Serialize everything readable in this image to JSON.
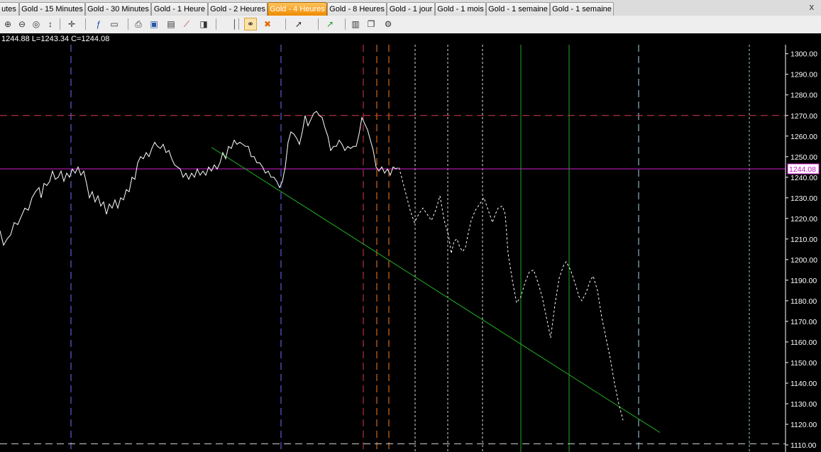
{
  "tabs": [
    {
      "label": "utes",
      "width": 27
    },
    {
      "label": "Gold - 15 Minutes",
      "width": 91
    },
    {
      "label": "Gold - 30 Minutes",
      "width": 91
    },
    {
      "label": "Gold - 1 Heure",
      "width": 78
    },
    {
      "label": "Gold - 2 Heures",
      "width": 82
    },
    {
      "label": "Gold - 4 Heures",
      "width": 82,
      "active": true
    },
    {
      "label": "Gold - 8 Heures",
      "width": 82
    },
    {
      "label": "Gold - 1 jour",
      "width": 66
    },
    {
      "label": "Gold - 1 mois",
      "width": 70
    },
    {
      "label": "Gold - 1 semaine",
      "width": 88
    },
    {
      "label": "Gold - 1 semaine",
      "width": 88
    }
  ],
  "close_label": "x",
  "toolbar": {
    "icons": [
      "zoom-in-icon",
      "zoom-out-icon",
      "zoom-fit-icon",
      "scale-icon",
      "crosshair-icon",
      "function-icon",
      "indicator-window-icon",
      "print-icon",
      "save-icon",
      "document-icon",
      "chart-line-icon",
      "save-template-icon",
      "vertical-line-icon",
      "link-icon",
      "cross-icon",
      "cursor-icon",
      "trendline-icon",
      "object-list-icon",
      "copy-icon",
      "tools-icon"
    ]
  },
  "ohlc_text": "1244.88 L=1243.34 C=1244.08",
  "chart_data": {
    "type": "line",
    "ylim": [
      1110,
      1303
    ],
    "yticks": [
      1110,
      1120,
      1130,
      1140,
      1150,
      1160,
      1170,
      1180,
      1190,
      1200,
      1210,
      1220,
      1230,
      1240,
      1250,
      1260,
      1270,
      1280,
      1290,
      1300
    ],
    "last_price": 1244.08,
    "last_price_label": "1244.08",
    "colors": {
      "price": "#ffffff",
      "hline_red": "#d43a55",
      "hline_magenta": "#d11fd1",
      "trend": "#22aa22"
    },
    "series_solid": [
      [
        0,
        1214
      ],
      [
        5,
        1207
      ],
      [
        10,
        1210
      ],
      [
        15,
        1212
      ],
      [
        20,
        1218
      ],
      [
        25,
        1217
      ],
      [
        30,
        1221
      ],
      [
        35,
        1225
      ],
      [
        40,
        1224
      ],
      [
        45,
        1230
      ],
      [
        50,
        1233
      ],
      [
        55,
        1235
      ],
      [
        58,
        1230
      ],
      [
        62,
        1237
      ],
      [
        66,
        1236
      ],
      [
        70,
        1238
      ],
      [
        74,
        1243
      ],
      [
        78,
        1239
      ],
      [
        82,
        1240
      ],
      [
        86,
        1243
      ],
      [
        90,
        1238
      ],
      [
        94,
        1242
      ],
      [
        98,
        1240
      ],
      [
        102,
        1244
      ],
      [
        106,
        1242
      ],
      [
        110,
        1245
      ],
      [
        114,
        1241
      ],
      [
        118,
        1243
      ],
      [
        122,
        1237
      ],
      [
        126,
        1230
      ],
      [
        130,
        1233
      ],
      [
        134,
        1228
      ],
      [
        138,
        1231
      ],
      [
        142,
        1226
      ],
      [
        146,
        1228
      ],
      [
        150,
        1222
      ],
      [
        154,
        1227
      ],
      [
        158,
        1225
      ],
      [
        162,
        1229
      ],
      [
        166,
        1225
      ],
      [
        170,
        1230
      ],
      [
        174,
        1229
      ],
      [
        178,
        1234
      ],
      [
        182,
        1233
      ],
      [
        186,
        1240
      ],
      [
        190,
        1239
      ],
      [
        194,
        1247
      ],
      [
        198,
        1250
      ],
      [
        202,
        1249
      ],
      [
        206,
        1252
      ],
      [
        210,
        1250
      ],
      [
        214,
        1254
      ],
      [
        218,
        1257
      ],
      [
        222,
        1255
      ],
      [
        226,
        1254
      ],
      [
        230,
        1256
      ],
      [
        234,
        1252
      ],
      [
        238,
        1253
      ],
      [
        242,
        1249
      ],
      [
        246,
        1246
      ],
      [
        250,
        1245
      ],
      [
        254,
        1244
      ],
      [
        258,
        1240
      ],
      [
        262,
        1242
      ],
      [
        266,
        1239
      ],
      [
        270,
        1242
      ],
      [
        274,
        1240
      ],
      [
        278,
        1244
      ],
      [
        282,
        1241
      ],
      [
        286,
        1243
      ],
      [
        290,
        1241
      ],
      [
        294,
        1245
      ],
      [
        298,
        1243
      ],
      [
        302,
        1246
      ],
      [
        306,
        1244
      ],
      [
        310,
        1247
      ],
      [
        314,
        1252
      ],
      [
        318,
        1249
      ],
      [
        322,
        1255
      ],
      [
        326,
        1254
      ],
      [
        330,
        1258
      ],
      [
        334,
        1256
      ],
      [
        338,
        1257
      ],
      [
        342,
        1256
      ],
      [
        346,
        1255
      ],
      [
        350,
        1255
      ],
      [
        354,
        1250
      ],
      [
        358,
        1250
      ],
      [
        362,
        1247
      ],
      [
        366,
        1247
      ],
      [
        370,
        1245
      ],
      [
        374,
        1242
      ],
      [
        378,
        1243
      ],
      [
        382,
        1240
      ],
      [
        386,
        1240
      ],
      [
        390,
        1238
      ],
      [
        394,
        1235
      ],
      [
        398,
        1238
      ],
      [
        402,
        1245
      ],
      [
        406,
        1257
      ],
      [
        410,
        1262
      ],
      [
        414,
        1261
      ],
      [
        418,
        1259
      ],
      [
        422,
        1256
      ],
      [
        426,
        1262
      ],
      [
        430,
        1270
      ],
      [
        434,
        1265
      ],
      [
        438,
        1268
      ],
      [
        442,
        1271
      ],
      [
        446,
        1272
      ],
      [
        450,
        1270
      ],
      [
        454,
        1269
      ],
      [
        458,
        1264
      ],
      [
        462,
        1260
      ],
      [
        466,
        1253
      ],
      [
        470,
        1255
      ],
      [
        474,
        1255
      ],
      [
        478,
        1258
      ],
      [
        482,
        1256
      ],
      [
        486,
        1253
      ],
      [
        490,
        1255
      ],
      [
        494,
        1254
      ],
      [
        498,
        1255
      ],
      [
        502,
        1255
      ],
      [
        506,
        1261
      ],
      [
        510,
        1269
      ],
      [
        514,
        1266
      ],
      [
        518,
        1263
      ],
      [
        522,
        1258
      ],
      [
        526,
        1253
      ],
      [
        530,
        1245
      ],
      [
        534,
        1243
      ],
      [
        538,
        1245
      ],
      [
        542,
        1242
      ],
      [
        546,
        1244
      ],
      [
        550,
        1241
      ],
      [
        554,
        1245
      ],
      [
        558,
        1244
      ]
    ],
    "series_dashed": [
      [
        558,
        1244
      ],
      [
        562,
        1245
      ],
      [
        566,
        1240
      ],
      [
        572,
        1232
      ],
      [
        578,
        1224
      ],
      [
        584,
        1218
      ],
      [
        590,
        1222
      ],
      [
        596,
        1225
      ],
      [
        602,
        1222
      ],
      [
        608,
        1219
      ],
      [
        614,
        1224
      ],
      [
        620,
        1231
      ],
      [
        626,
        1219
      ],
      [
        632,
        1212
      ],
      [
        636,
        1203
      ],
      [
        640,
        1209
      ],
      [
        644,
        1210
      ],
      [
        648,
        1206
      ],
      [
        652,
        1204
      ],
      [
        656,
        1206
      ],
      [
        660,
        1213
      ],
      [
        664,
        1219
      ],
      [
        670,
        1224
      ],
      [
        676,
        1227
      ],
      [
        682,
        1230
      ],
      [
        688,
        1224
      ],
      [
        694,
        1218
      ],
      [
        698,
        1222
      ],
      [
        702,
        1225
      ],
      [
        708,
        1226
      ],
      [
        712,
        1222
      ],
      [
        716,
        1203
      ],
      [
        722,
        1190
      ],
      [
        728,
        1179
      ],
      [
        734,
        1182
      ],
      [
        740,
        1189
      ],
      [
        746,
        1194
      ],
      [
        752,
        1195
      ],
      [
        758,
        1189
      ],
      [
        764,
        1182
      ],
      [
        770,
        1172
      ],
      [
        776,
        1162
      ],
      [
        782,
        1178
      ],
      [
        788,
        1191
      ],
      [
        794,
        1197
      ],
      [
        798,
        1199
      ],
      [
        804,
        1195
      ],
      [
        810,
        1189
      ],
      [
        816,
        1182
      ],
      [
        820,
        1180
      ],
      [
        826,
        1184
      ],
      [
        832,
        1190
      ],
      [
        836,
        1192
      ],
      [
        842,
        1185
      ],
      [
        848,
        1172
      ],
      [
        854,
        1162
      ],
      [
        860,
        1152
      ],
      [
        866,
        1140
      ],
      [
        872,
        1130
      ],
      [
        878,
        1122
      ]
    ]
  },
  "guides": {
    "trendline": [
      [
        298,
        1254.5
      ],
      [
        930,
        1116
      ]
    ],
    "hlines": [
      {
        "y": 1270,
        "color": "#d43a55",
        "dash": "10,6",
        "w": 1
      },
      {
        "y": 1244.08,
        "color": "#d11fd1",
        "dash": "",
        "w": 1
      },
      {
        "y": 1110.5,
        "color": "#cfcfcf",
        "dash": "10,6",
        "w": 1
      }
    ],
    "vlines": [
      {
        "x": 100,
        "color": "#6f6fff",
        "dash": "10,6"
      },
      {
        "x": 396,
        "color": "#6f6fff",
        "dash": "10,6"
      },
      {
        "x": 512,
        "color": "#d43a55",
        "dash": "10,6"
      },
      {
        "x": 531,
        "color": "#ff7b1a",
        "dash": "10,6"
      },
      {
        "x": 548,
        "color": "#ff7b1a",
        "dash": "10,6"
      },
      {
        "x": 585,
        "color": "#dddddd",
        "dash": "3,3"
      },
      {
        "x": 631,
        "color": "#dddddd",
        "dash": "3,3"
      },
      {
        "x": 680,
        "color": "#dddddd",
        "dash": "3,3"
      },
      {
        "x": 734,
        "color": "#22aa22",
        "dash": ""
      },
      {
        "x": 802,
        "color": "#22aa22",
        "dash": ""
      },
      {
        "x": 900,
        "color": "#a9d6e8",
        "dash": "10,6"
      },
      {
        "x": 1056,
        "color": "#9fd6a9",
        "dash": "3,3"
      }
    ]
  }
}
